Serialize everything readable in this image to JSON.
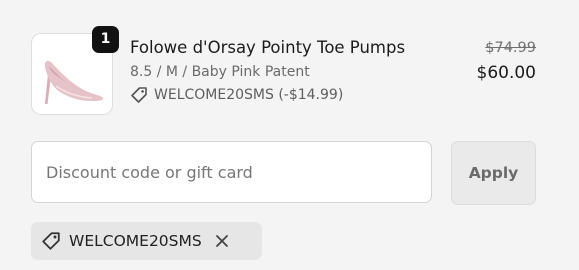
{
  "line_item": {
    "quantity": "1",
    "title": "Folowe d'Orsay Pointy Toe Pumps",
    "variant": "8.5 / M / Baby Pink Patent",
    "discount_line": "WELCOME20SMS (-$14.99)",
    "compare_at_price": "$74.99",
    "price": "$60.00",
    "image_icon": "pink-pump-shoe"
  },
  "discount": {
    "placeholder": "Discount code or gift card",
    "value": "",
    "apply_label": "Apply"
  },
  "applied_code": {
    "label": "WELCOME20SMS",
    "tag_icon": "tag-icon",
    "remove_icon": "close-icon"
  },
  "colors": {
    "background": "#f4f4f4",
    "badge": "#111111",
    "shoe_pink": "#e6c3c8"
  }
}
